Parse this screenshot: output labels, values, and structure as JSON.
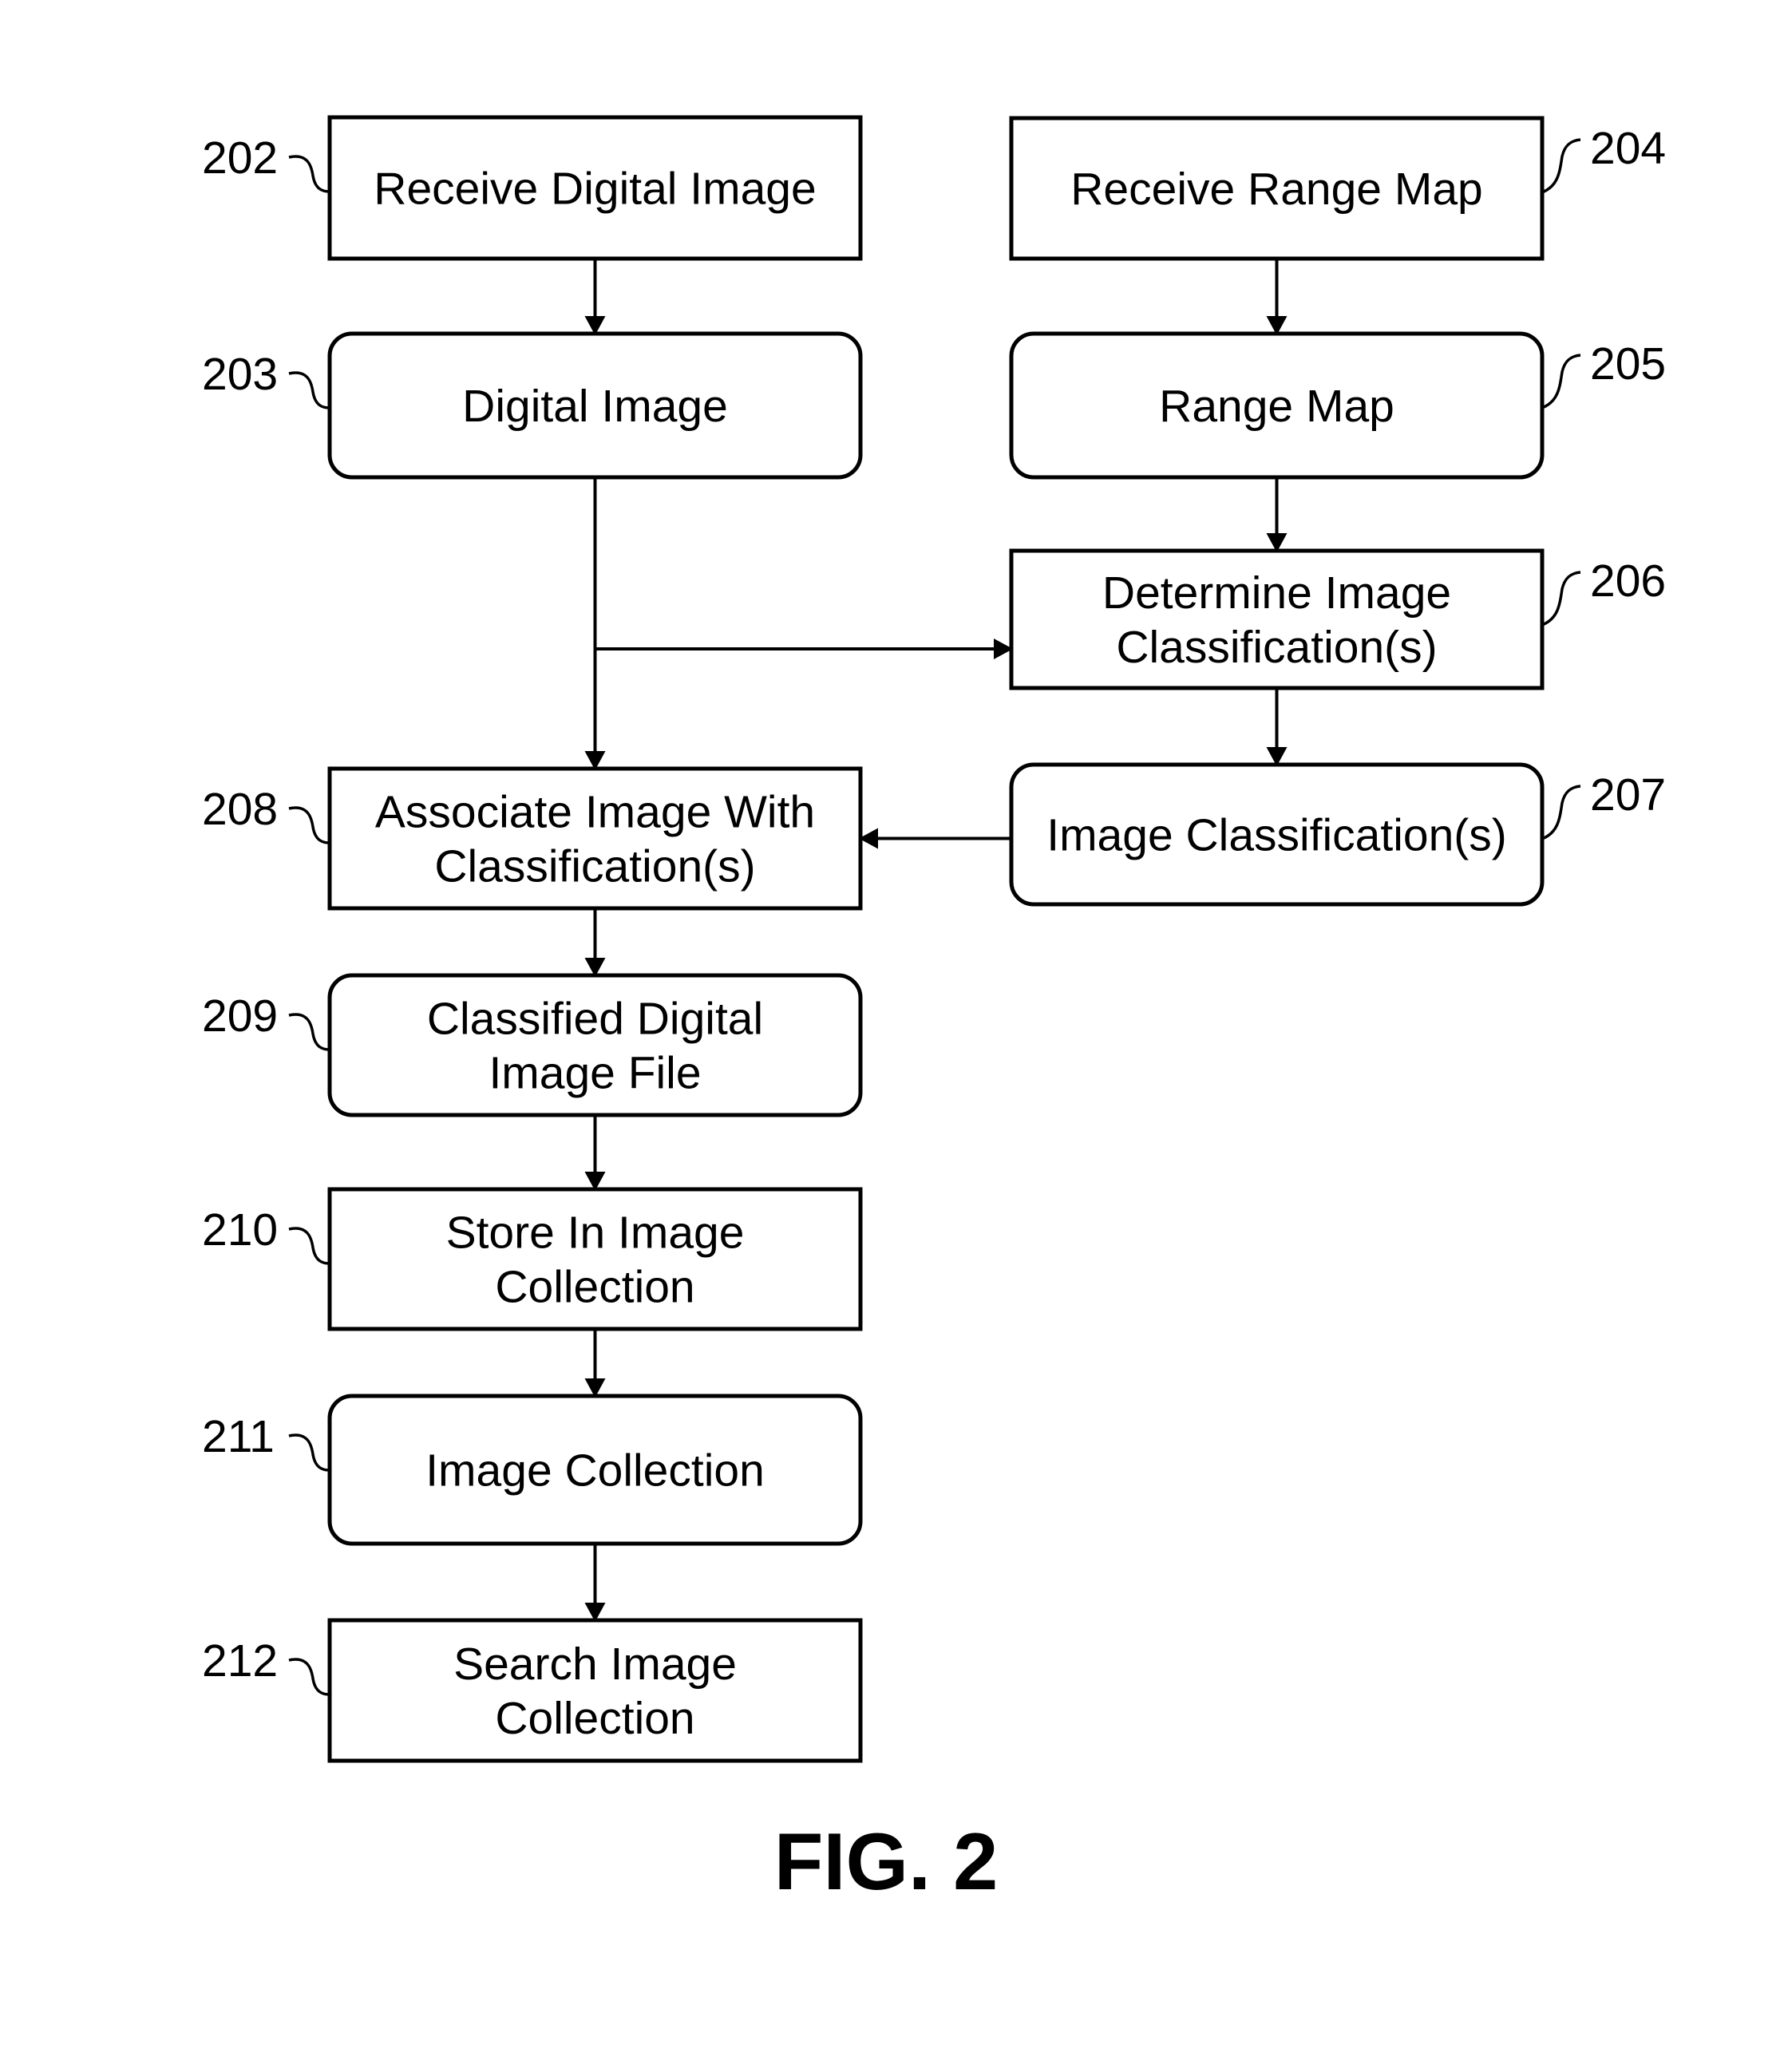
{
  "figure_label": "FIG. 2",
  "nodes": [
    {
      "id": "202",
      "ref": "202",
      "shape": "rect",
      "lines": [
        "Receive Digital Image"
      ]
    },
    {
      "id": "203",
      "ref": "203",
      "shape": "round",
      "lines": [
        "Digital Image"
      ]
    },
    {
      "id": "204",
      "ref": "204",
      "shape": "rect",
      "lines": [
        "Receive Range Map"
      ]
    },
    {
      "id": "205",
      "ref": "205",
      "shape": "round",
      "lines": [
        "Range Map"
      ]
    },
    {
      "id": "206",
      "ref": "206",
      "shape": "rect",
      "lines": [
        "Determine Image",
        "Classification(s)"
      ]
    },
    {
      "id": "207",
      "ref": "207",
      "shape": "round",
      "lines": [
        "Image Classification(s)"
      ]
    },
    {
      "id": "208",
      "ref": "208",
      "shape": "rect",
      "lines": [
        "Associate Image With",
        "Classification(s)"
      ]
    },
    {
      "id": "209",
      "ref": "209",
      "shape": "round",
      "lines": [
        "Classified Digital",
        "Image File"
      ]
    },
    {
      "id": "210",
      "ref": "210",
      "shape": "rect",
      "lines": [
        "Store In Image",
        "Collection"
      ]
    },
    {
      "id": "211",
      "ref": "211",
      "shape": "round",
      "lines": [
        "Image Collection"
      ]
    },
    {
      "id": "212",
      "ref": "212",
      "shape": "rect",
      "lines": [
        "Search Image",
        "Collection"
      ]
    }
  ],
  "edges": [
    {
      "from": "202",
      "to": "203"
    },
    {
      "from": "204",
      "to": "205"
    },
    {
      "from": "205",
      "to": "206"
    },
    {
      "from": "203",
      "to": "206"
    },
    {
      "from": "203",
      "to": "208"
    },
    {
      "from": "206",
      "to": "207"
    },
    {
      "from": "207",
      "to": "208"
    },
    {
      "from": "208",
      "to": "209"
    },
    {
      "from": "209",
      "to": "210"
    },
    {
      "from": "210",
      "to": "211"
    },
    {
      "from": "211",
      "to": "212"
    }
  ]
}
